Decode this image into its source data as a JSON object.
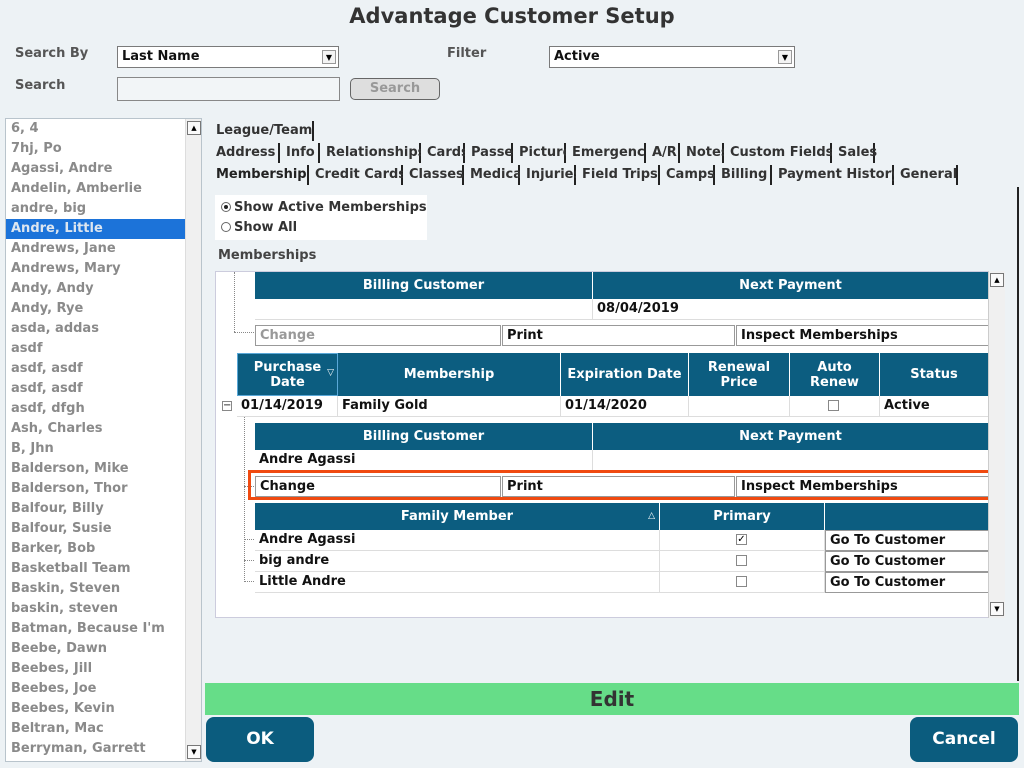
{
  "window": {
    "title": "Advantage Customer Setup"
  },
  "search": {
    "search_by_label": "Search By",
    "search_by_value": "Last Name",
    "filter_label": "Filter",
    "filter_value": "Active",
    "search_label": "Search",
    "search_value": "",
    "search_button": "Search"
  },
  "customers": [
    {
      "name": "6, 4"
    },
    {
      "name": "7hj, Po"
    },
    {
      "name": "Agassi, Andre"
    },
    {
      "name": "Andelin, Amberlie"
    },
    {
      "name": "andre, big"
    },
    {
      "name": "Andre, Little"
    },
    {
      "name": "Andrews, Jane"
    },
    {
      "name": "Andrews, Mary"
    },
    {
      "name": "Andy, Andy"
    },
    {
      "name": "Andy, Rye"
    },
    {
      "name": "asda, addas"
    },
    {
      "name": "asdf"
    },
    {
      "name": "asdf, asdf"
    },
    {
      "name": "asdf, asdf"
    },
    {
      "name": "asdf, dfgh"
    },
    {
      "name": "Ash, Charles"
    },
    {
      "name": "B, Jhn"
    },
    {
      "name": "Balderson, Mike"
    },
    {
      "name": "Balderson, Thor"
    },
    {
      "name": "Balfour, Billy"
    },
    {
      "name": "Balfour, Susie"
    },
    {
      "name": "Barker, Bob"
    },
    {
      "name": "Basketball Team"
    },
    {
      "name": "Baskin, Steven"
    },
    {
      "name": "baskin, steven"
    },
    {
      "name": "Batman, Because I'm"
    },
    {
      "name": "Beebe, Dawn"
    },
    {
      "name": "Beebes, Jill"
    },
    {
      "name": "Beebes, Joe"
    },
    {
      "name": "Beebes, Kevin"
    },
    {
      "name": "Beltran, Mac"
    },
    {
      "name": "Berryman, Garrett"
    }
  ],
  "selected_customer": "Andre, Little",
  "tabs": {
    "row1": [
      "League/Team"
    ],
    "row2": [
      "Address",
      "Info",
      "Relationships",
      "Cards",
      "Passes",
      "Picture",
      "Emergency",
      "A/R",
      "Notes",
      "Custom Fields",
      "Sales"
    ],
    "row3": [
      "Memberships",
      "Credit Cards",
      "Classes",
      "Medical",
      "Injuries",
      "Field Trips",
      "Camps",
      "Billing",
      "Payment History",
      "General"
    ],
    "active": "Memberships"
  },
  "memberships": {
    "show_active": "Show Active Memberships",
    "show_all": "Show All",
    "section_label": "Memberships",
    "billing_header": "Billing Customer",
    "next_payment_header": "Next Payment",
    "top_billing_customer": "",
    "top_next_payment": "08/04/2019",
    "change": "Change",
    "print": "Print",
    "inspect": "Inspect Memberships",
    "columns": {
      "purchase_date": "Purchase Date",
      "membership": "Membership",
      "expiration_date": "Expiration Date",
      "renewal_price": "Renewal Price",
      "auto_renew": "Auto Renew",
      "status": "Status"
    },
    "row": {
      "purchase_date": "01/14/2019",
      "membership": "Family Gold",
      "expiration_date": "01/14/2020",
      "renewal_price": "",
      "status": "Active"
    },
    "row_billing_customer": "Andre Agassi",
    "row_next_payment": "",
    "family_header": "Family Member",
    "primary_header": "Primary",
    "go_to_customer": "Go To Customer",
    "family": [
      {
        "name": "Andre Agassi",
        "primary": true
      },
      {
        "name": "big andre",
        "primary": false
      },
      {
        "name": "Little Andre",
        "primary": false
      }
    ]
  },
  "footer": {
    "edit": "Edit",
    "ok": "OK",
    "cancel": "Cancel"
  },
  "colors": {
    "header": "#0c5d80",
    "selected": "#1c73d9",
    "edit_bar": "#66dd88",
    "highlight": "#f04a10"
  }
}
